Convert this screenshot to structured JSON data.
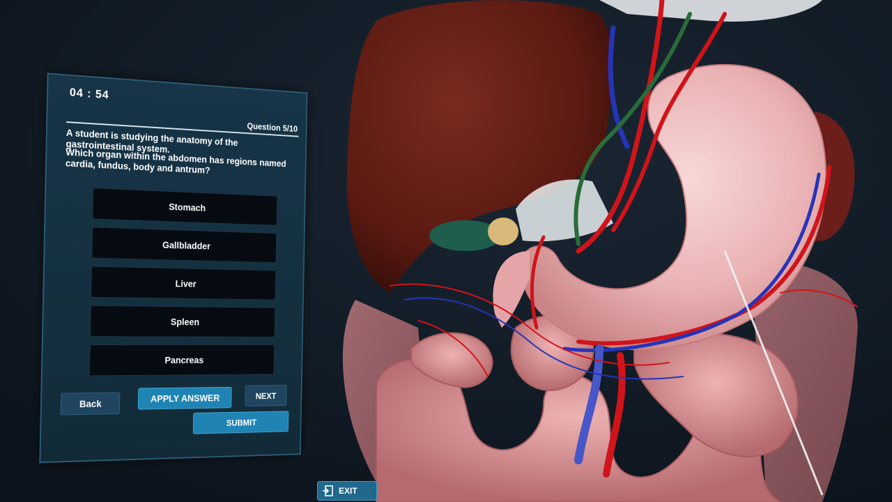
{
  "quiz": {
    "timer": "04 : 54",
    "question_counter": "Question 5/10",
    "scenario": "A student is studying the anatomy of the gastrointestinal system.",
    "question": "Which organ within the abdomen has regions named cardia, fundus, body and antrum?",
    "options": [
      {
        "label": "Stomach"
      },
      {
        "label": "Gallbladder"
      },
      {
        "label": "Liver"
      },
      {
        "label": "Spleen"
      },
      {
        "label": "Pancreas"
      }
    ],
    "buttons": {
      "back": "Back",
      "apply_answer": "APPLY ANSWER",
      "next": "NEXT",
      "submit": "SUBMIT"
    }
  },
  "exit": {
    "label": "EXIT",
    "icon": "exit-door-icon"
  },
  "colors": {
    "panel_bg": "#173448",
    "option_bg": "#060b12",
    "primary_button": "#1f84b3",
    "secondary_button": "#1f4560",
    "scene_bg": "#0f1a26"
  }
}
